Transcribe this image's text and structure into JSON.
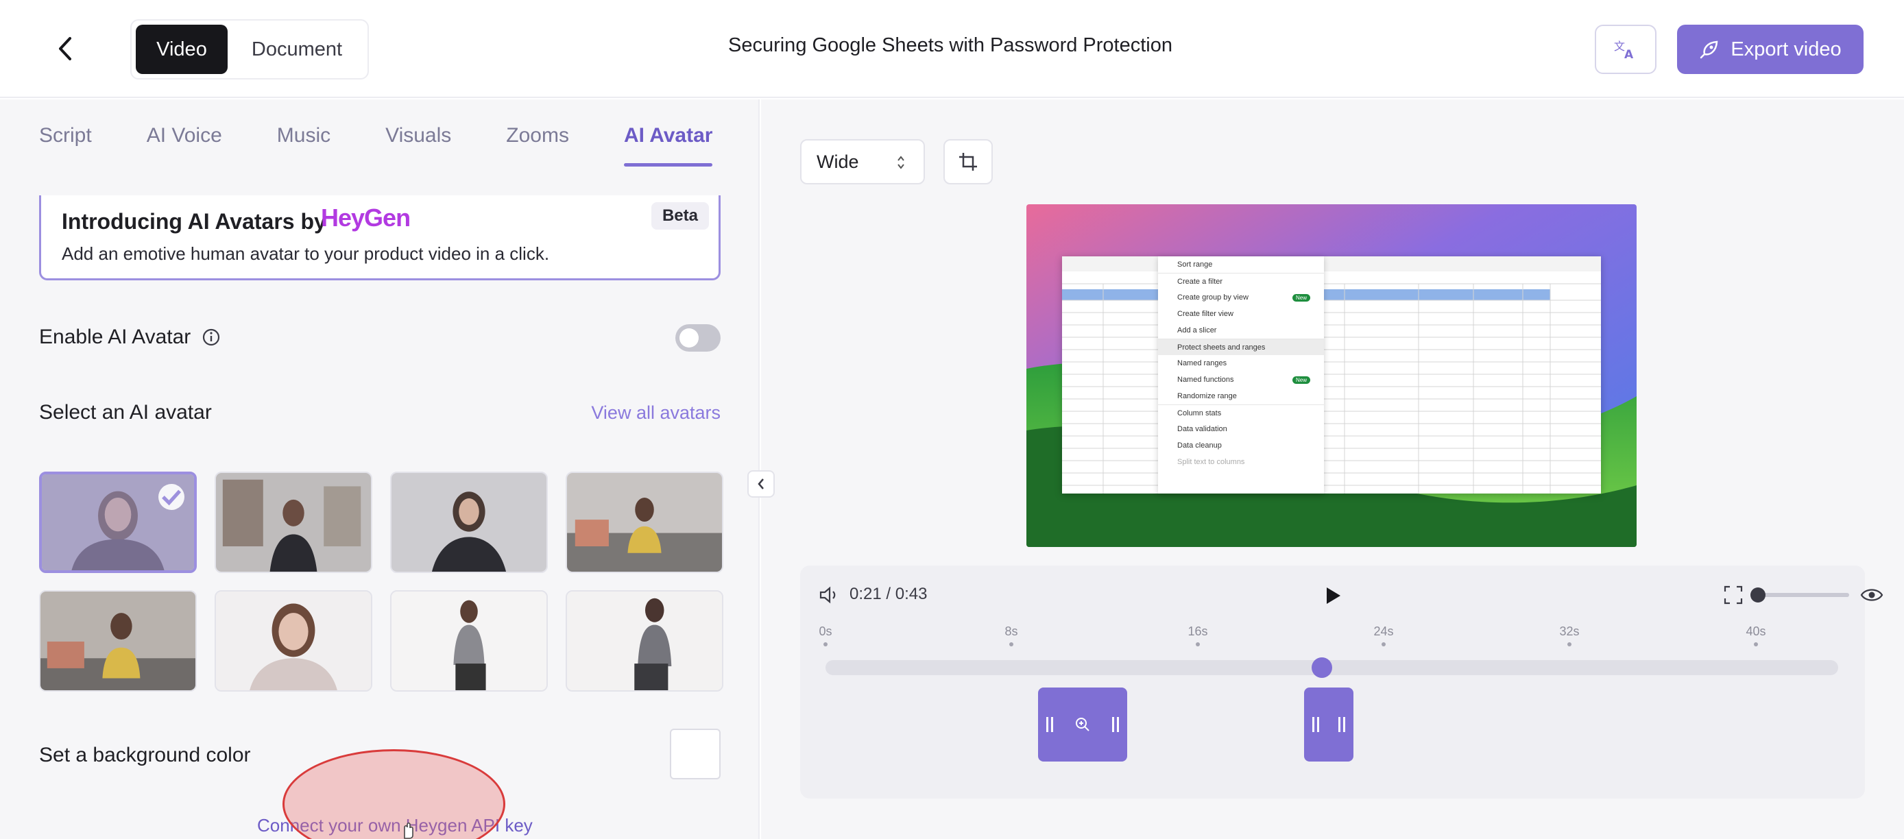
{
  "header": {
    "back_label": "Back",
    "mode_video": "Video",
    "mode_document": "Document",
    "title": "Securing Google Sheets with Password Protection",
    "export_label": "Export video"
  },
  "tabs": [
    "Script",
    "AI Voice",
    "Music",
    "Visuals",
    "Zooms",
    "AI Avatar"
  ],
  "intro": {
    "title": "Introducing AI Avatars by",
    "brand": "HeyGen",
    "description": "Add an emotive human avatar to your product video in a click.",
    "badge": "Beta"
  },
  "enable_avatar": {
    "label": "Enable AI Avatar",
    "enabled": false
  },
  "avatar_select": {
    "label": "Select an AI avatar",
    "view_all": "View all avatars",
    "selected_index": 0,
    "count": 8
  },
  "background": {
    "label": "Set a background color",
    "color": "#ffffff"
  },
  "api_link": "Connect your own Heygen API key",
  "preview": {
    "aspect": "Wide",
    "menu_items": [
      "Sort range",
      "Create a filter",
      "Create group by view",
      "Create filter view",
      "Add a slicer",
      "Protect sheets and ranges",
      "Named ranges",
      "Named functions",
      "Randomize range",
      "Column stats",
      "Data validation",
      "Data cleanup",
      "Split text to columns"
    ],
    "badge_new": "New"
  },
  "player": {
    "current_time": "0:21",
    "duration": "0:43",
    "time_display": "0:21 / 0:43",
    "ticks": [
      "0s",
      "8s",
      "16s",
      "24s",
      "32s",
      "40s"
    ],
    "progress_fraction": 0.49,
    "zoom_level_fraction": 0.0
  },
  "colors": {
    "accent": "#7f6fd4",
    "dark_button": "#17171b",
    "heygen_brand": "#b23ae1",
    "highlight_ellipse": "#d93b3b"
  }
}
